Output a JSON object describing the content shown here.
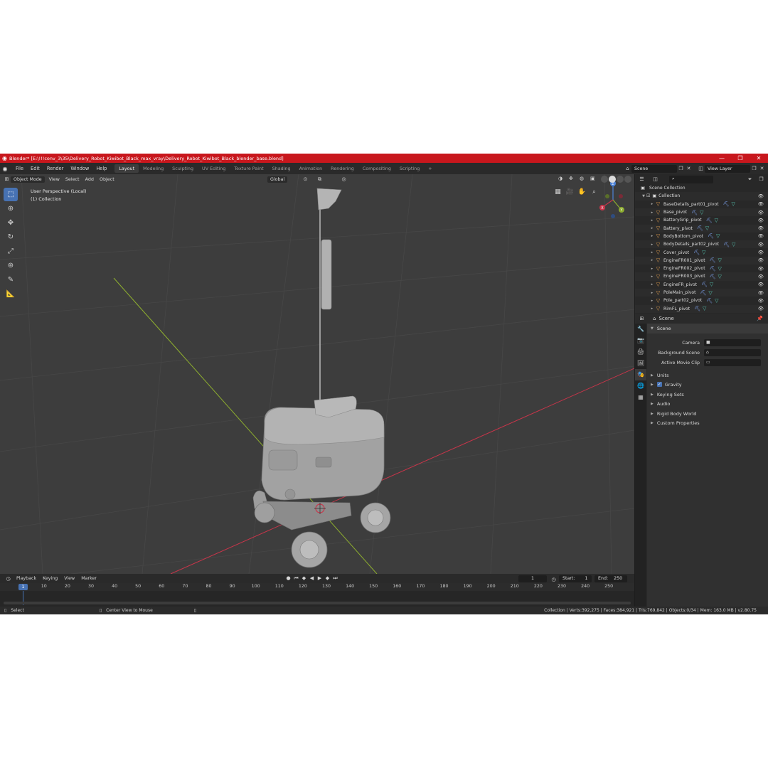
{
  "window": {
    "title": "Blender* [E:\\!!!conv_3\\35\\Delivery_Robot_Kiwibot_Black_max_vray\\Delivery_Robot_Kiwibot_Black_blender_base.blend]",
    "controls": [
      "—",
      "❐",
      "✕"
    ]
  },
  "menu": [
    "File",
    "Edit",
    "Render",
    "Window",
    "Help"
  ],
  "workspaces": [
    "Layout",
    "Modeling",
    "Sculpting",
    "UV Editing",
    "Texture Paint",
    "Shading",
    "Animation",
    "Rendering",
    "Compositing",
    "Scripting"
  ],
  "active_workspace": "Layout",
  "topbar_right": {
    "scene": "Scene",
    "view_layer": "View Layer"
  },
  "viewport": {
    "mode": "Object Mode",
    "menus": [
      "View",
      "Select",
      "Add",
      "Object"
    ],
    "orientation": "Global",
    "info_line1": "User Perspective (Local)",
    "info_line2": "(1) Collection",
    "gizmo": {
      "z": "Z",
      "y": "Y",
      "x": "X"
    },
    "colors": {
      "background": "#3d3d3d",
      "grid": "#474747",
      "x_axis": "#c8354a",
      "y_axis": "#8dad2f",
      "model": "#a9a9a9"
    }
  },
  "timeline": {
    "menus": [
      "Playback",
      "Keying",
      "View",
      "Marker"
    ],
    "current_frame": "1",
    "start_label": "Start:",
    "start": "1",
    "end_label": "End:",
    "end": "250",
    "ticks": [
      "1",
      "10",
      "20",
      "30",
      "40",
      "50",
      "60",
      "70",
      "80",
      "90",
      "100",
      "110",
      "120",
      "130",
      "140",
      "150",
      "160",
      "170",
      "180",
      "190",
      "200",
      "210",
      "220",
      "230",
      "240",
      "250"
    ]
  },
  "statusbar": {
    "select": "Select",
    "center_view": "Center View to Mouse",
    "stats": "Collection | Verts:392,275 | Faces:384,921 | Tris:769,842 | Objects:0/34 | Mem: 163.0 MB | v2.80.75"
  },
  "outliner": {
    "root": "Scene Collection",
    "collection": "Collection",
    "items": [
      "BaseDetails_part01_pivot",
      "Base_pivot",
      "BatteryGrip_pivot",
      "Battery_pivot",
      "BodyBottom_pivot",
      "BodyDetails_part02_pivot",
      "Cover_pivot",
      "EngineFR001_pivot",
      "EngineFR002_pivot",
      "EngineFR003_pivot",
      "EngineFR_pivot",
      "PoleMain_pivot",
      "Pole_part02_pivot",
      "RimFL_pivot"
    ]
  },
  "properties": {
    "context": "Scene",
    "panel": "Scene",
    "fields": [
      {
        "label": "Camera",
        "value": ""
      },
      {
        "label": "Background Scene",
        "value": ""
      },
      {
        "label": "Active Movie Clip",
        "value": ""
      }
    ],
    "subpanels": [
      "Units",
      "Gravity",
      "Keying Sets",
      "Audio",
      "Rigid Body World",
      "Custom Properties"
    ]
  }
}
